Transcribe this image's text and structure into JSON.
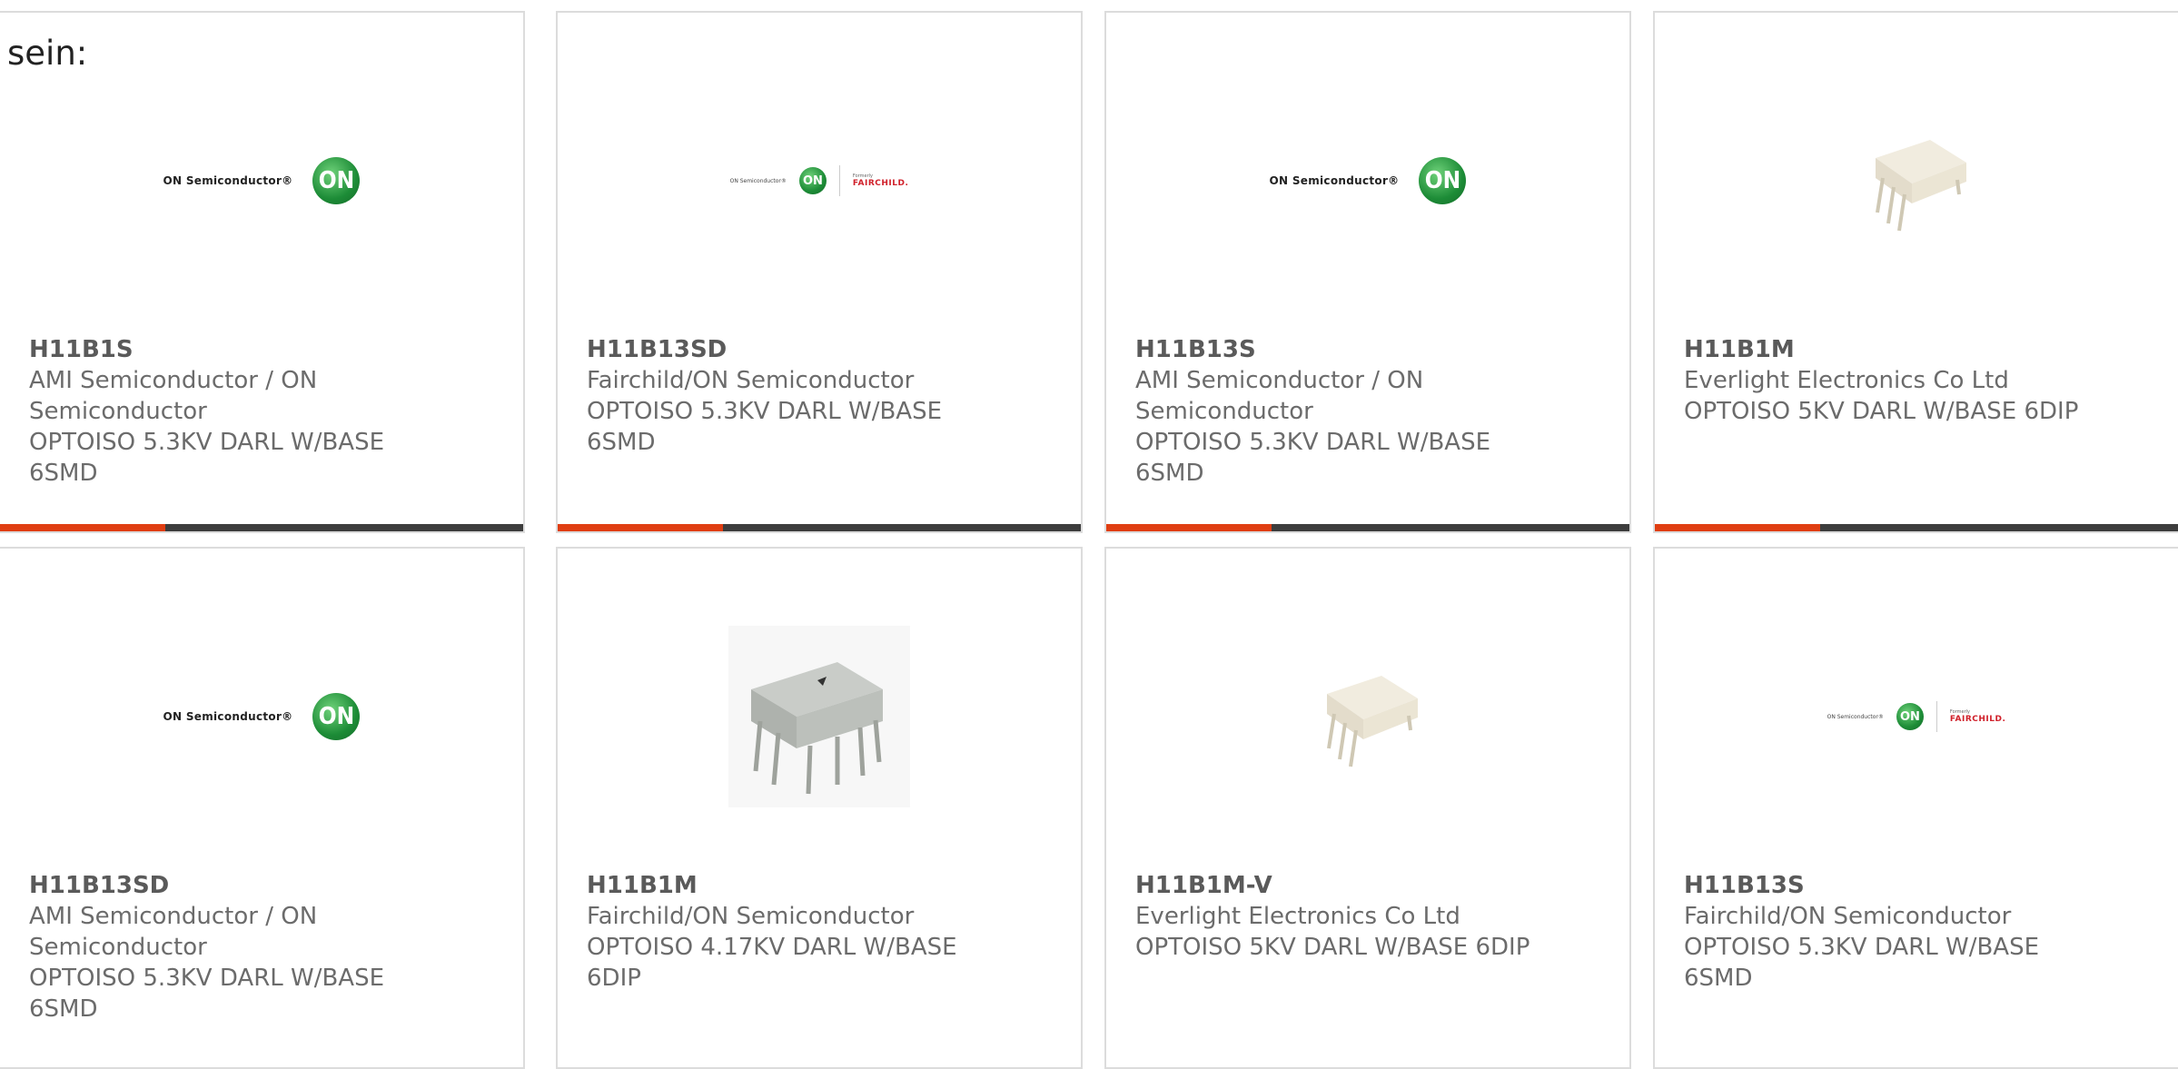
{
  "intro_text": "sein:",
  "logo_texts": {
    "on_semi": "ON Semiconductor®",
    "on": "ON",
    "formerly": "Formerly",
    "fairchild": "FAIRCHILD."
  },
  "colors": {
    "accent_bar": "#e03e12",
    "dark_bar": "#3d3d3d",
    "card_border": "#dcdcdc",
    "text_gray": "#6b6b6b"
  },
  "products": [
    {
      "part_number": "H11B1S",
      "manufacturer": "AMI Semiconductor / ON Semiconductor",
      "description": "OPTOISO 5.3KV DARL W/BASE 6SMD",
      "image": "on-semiconductor-logo"
    },
    {
      "part_number": "H11B13SD",
      "manufacturer": "Fairchild/ON Semiconductor",
      "description": "OPTOISO 5.3KV DARL W/BASE 6SMD",
      "image": "on-fairchild-logo"
    },
    {
      "part_number": "H11B13S",
      "manufacturer": "AMI Semiconductor / ON Semiconductor",
      "description": "OPTOISO 5.3KV DARL W/BASE 6SMD",
      "image": "on-semiconductor-logo"
    },
    {
      "part_number": "H11B1M",
      "manufacturer": "Everlight Electronics Co Ltd",
      "description": "OPTOISO 5KV DARL W/BASE 6DIP",
      "image": "dip-chip-white"
    },
    {
      "part_number": "H11B13SD",
      "manufacturer": "AMI Semiconductor / ON Semiconductor",
      "description": "OPTOISO 5.3KV DARL W/BASE 6SMD",
      "image": "on-semiconductor-logo"
    },
    {
      "part_number": "H11B1M",
      "manufacturer": "Fairchild/ON Semiconductor",
      "description": "OPTOISO 4.17KV DARL W/BASE 6DIP",
      "image": "dip-chip-gray"
    },
    {
      "part_number": "H11B1M-V",
      "manufacturer": "Everlight Electronics Co Ltd",
      "description": "OPTOISO 5KV DARL W/BASE 6DIP",
      "image": "dip-chip-white"
    },
    {
      "part_number": "H11B13S",
      "manufacturer": "Fairchild/ON Semiconductor",
      "description": "OPTOISO 5.3KV DARL W/BASE 6SMD",
      "image": "on-fairchild-logo"
    }
  ]
}
